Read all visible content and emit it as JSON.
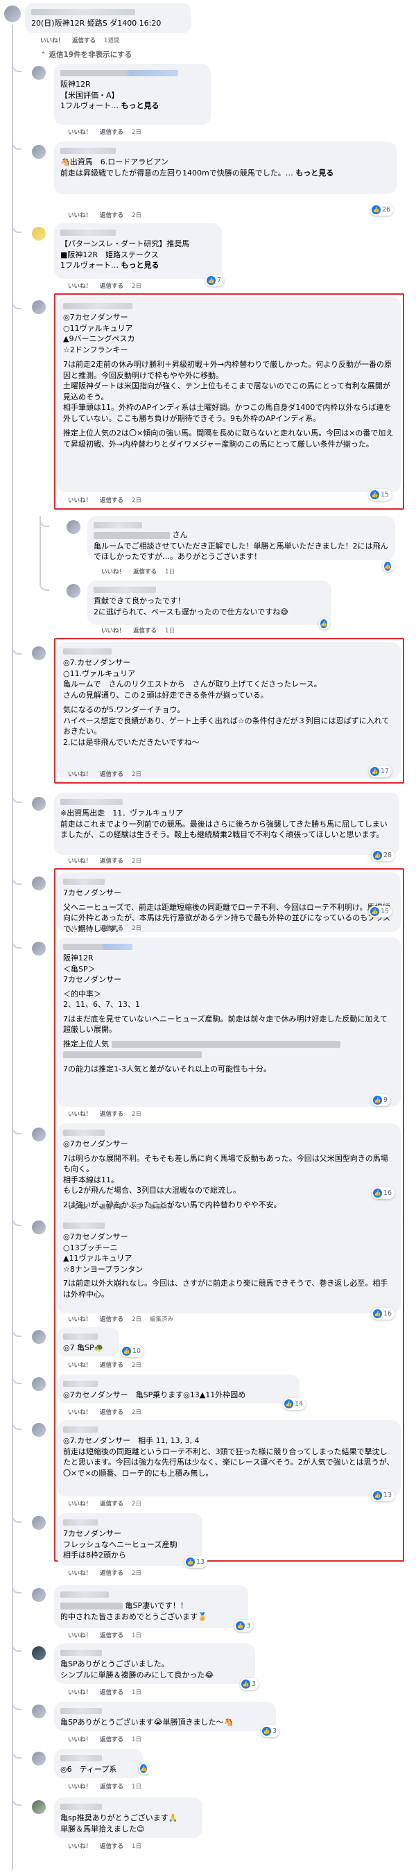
{
  "top": {
    "text": "20(日)阪神12R 姫路S ダ1400 16:20",
    "actions": [
      "いいね！",
      "返信する",
      "1週間"
    ]
  },
  "hide_replies": "返信19件を非表示にする",
  "comments": [
    {
      "lines": [
        "阪神12R",
        "【米国評価・A】",
        "1フルヴォート… もっと見る"
      ],
      "actions": [
        "いいね！",
        "返信する",
        "2日"
      ]
    },
    {
      "lines": [
        "🐴出資馬　6.ロードアラビアン",
        "前走は昇級戦でしたが得意の左回り1400mで快勝の競馬でした。… もっと見る"
      ],
      "actions": [
        "いいね！",
        "返信する",
        "2日"
      ],
      "reactions": "26"
    },
    {
      "lines": [
        "【パターンスレ・ダート研究】推奨馬",
        "■阪神12R　姫路ステークス",
        "1フルヴォート… もっと見る"
      ],
      "actions": [
        "いいね！",
        "返信する",
        "2日"
      ],
      "reactions": "7"
    },
    {
      "lines": [
        "◎7カセノダンサー",
        "○11ヴァルキュリア",
        "▲9バーニングペスカ",
        "☆2ドンフランキー",
        "",
        "7は前走2走前の休み明け勝利＋昇級初戦＋外→内枠替わりで厳しかった。何より反動が一番の原因と推測。今回反動明けで枠もやや外に移動。",
        "土曜阪神ダートは米国指向が強く、テン上位もそこまで居ないのでこの馬にとって有利な展開が見込めそう。",
        "相手筆頭は11。外枠のAPインディ系は土曜好調。かつこの馬自身ダ1400で内枠以外ならば連を外していない。ここも勝ち負けが期待できそう。9も外枠のAPインディ系。",
        "",
        "推定上位人気の2は〇×傾向の強い馬。間隔を長めに取らないと走れない馬。今回は×の番で加えて昇級初戦、外→内枠替わりとダイワメジャー産駒のこの馬にとって厳しい条件が揃った。"
      ],
      "actions": [
        "いいね！",
        "返信する",
        "2日"
      ],
      "reactions": "15"
    },
    {
      "lines": [
        "さん",
        "亀ルームでご相談させていただき正解でした！単勝と馬単いただきました！2には飛んでほしかったですが…。ありがとうございます！"
      ],
      "actions": [
        "いいね！",
        "返信する",
        "1日"
      ]
    },
    {
      "lines": [
        "貢献できて良かったです！",
        "2に逃げられて、ベースも遅かったので仕方ないですね😅"
      ],
      "actions": [
        "いいね！",
        "返信する",
        "1日"
      ]
    },
    {
      "lines": [
        "◎7.カセノダンサー",
        "○11.ヴァルキュリア",
        "亀ルームで　さんのリクエストから　さんが取り上げてくださったレース。",
        "さんの見解通り、この２頭は好走できる条件が揃っている。",
        "",
        "気になるのが5.ワンダーイチョウ。",
        "ハイペース想定で良績があり、ゲート上手く出れば☆の条件付きだが３列目には忍ばずに入れておきたい。",
        "2.には是非飛んでいただきたいですね〜"
      ],
      "actions": [
        "いいね！",
        "返信する",
        "2日"
      ],
      "reactions": "17"
    },
    {
      "lines": [
        "※出資馬出走　11．ヴァルキュリア",
        "前走はこれまでより一列前での競馬。最後はさらに後ろから強襲してきた勝ち馬に屈してしまいましたが、この経験は生きそう。鞍上も継続騎乗2戦目で不利なく頑張ってほしいと思います。"
      ],
      "actions": [
        "いいね！",
        "返信する",
        "2日"
      ],
      "reactions": "28"
    },
    {
      "lines": [
        "7カセノダンサー",
        "",
        "父ヘニーヒューズで、前走は距離短縮後の同距離でローテ不利、今回はローテ不利明け。馬場傾向に外枠とあったが、本馬は先行意欲があるテン持ちで最も外枠の並びになっているのもプラスで、期待します。"
      ],
      "actions": [
        "いいね！",
        "返信する",
        "2日"
      ],
      "reactions": "15"
    },
    {
      "lines": [
        "阪神12R",
        "＜亀SP＞",
        "7カセノダンサー",
        "",
        "＜的中率＞",
        "2、11、6、7、13、1",
        "",
        "7はまだ底を見せていないヘニーヒューズ産駒。前走は前々走で休み明け好走した反動に加えて超厳しい展開。",
        "",
        "推定上位人気",
        "",
        "7の能力は推定1-3人気と差がないそれ以上の可能性も十分。"
      ],
      "actions": [
        "いいね！",
        "返信する",
        "2日"
      ],
      "reactions": "9"
    },
    {
      "lines": [
        "◎7カセノダンサー",
        "",
        "7は明らかな展開不利。そもそも差し馬に向く馬場で反動もあった。今回は父米国型向きの馬場も向く。",
        "相手本線は11。",
        "もし2が飛んだ場合、3列目は大混戦なので総流し。",
        "",
        "2は強いが、砂をかぶったことがない馬で内枠替わりやや不安。"
      ],
      "actions": [
        "いいね！",
        "返信する",
        "2日",
        "編集済み"
      ],
      "reactions": "16"
    },
    {
      "lines": [
        "◎7カセノダンサー",
        "○13ブッチーニ",
        "▲11ヴァルキュリア",
        "☆8ナンヨープランタン",
        "",
        "7は前走以外大崩れなし。今回は、さすがに前走より楽に競馬できそうで、巻き返し必至。相手は外枠中心。"
      ],
      "actions": [
        "いいね！",
        "返信する",
        "2日",
        "編集済み"
      ],
      "reactions": "16"
    },
    {
      "lines": [
        "◎7 亀SP🐢"
      ],
      "actions": [
        "いいね！",
        "返信する",
        "2日"
      ],
      "reactions": "10"
    },
    {
      "lines": [
        "◎7カセノダンサー　亀SP乗ります◎13▲11外枠固め"
      ],
      "actions": [
        "いいね！",
        "返信する",
        "2日"
      ],
      "reactions": "14"
    },
    {
      "lines": [
        "◎7.カセノダンサー　相手 11, 13, 3, 4",
        "前走は短縮後の同距離というローテ不利と、3頭で狂った様に競り合ってしまった結果で撃沈したと思います。今回は強力な先行馬は少なく、楽にレース運べそう。2が人気で強いとは思うが、〇×で×の順番、ローテ的にも上積み無し。"
      ],
      "actions": [
        "いいね！",
        "返信する",
        "2日"
      ],
      "reactions": "13"
    },
    {
      "lines": [
        "7カセノダンサー",
        "フレッシュなヘニーヒューズ産駒",
        "相手は8枠2頭から"
      ],
      "actions": [
        "いいね！",
        "返信する",
        "2日"
      ],
      "reactions": "13"
    },
    {
      "lines": [
        "亀SP凄いです！！",
        "的中された皆さまおめでとうございます🏅"
      ],
      "actions": [
        "いいね！",
        "返信する",
        "1日"
      ],
      "reactions": "3"
    },
    {
      "lines": [
        "亀SPありがとうございました。",
        "シンプルに単勝＆複勝のみにして良かった😂"
      ],
      "actions": [
        "いいね！",
        "返信する",
        "1日"
      ],
      "reactions": "3"
    },
    {
      "lines": [
        "亀SPありがとうございます😭単勝頂きました〜🐴"
      ],
      "actions": [
        "いいね！",
        "返信する",
        "1日"
      ],
      "reactions": "3"
    },
    {
      "lines": [
        "◎6　ティープ系"
      ],
      "actions": [
        "いいね！",
        "返信する",
        "1日"
      ]
    },
    {
      "lines": [
        "亀sp推奨ありがとうございます🙏",
        "単勝＆馬単拾えました😊"
      ],
      "actions": [
        "いいね！",
        "返信する",
        "1日"
      ]
    }
  ]
}
